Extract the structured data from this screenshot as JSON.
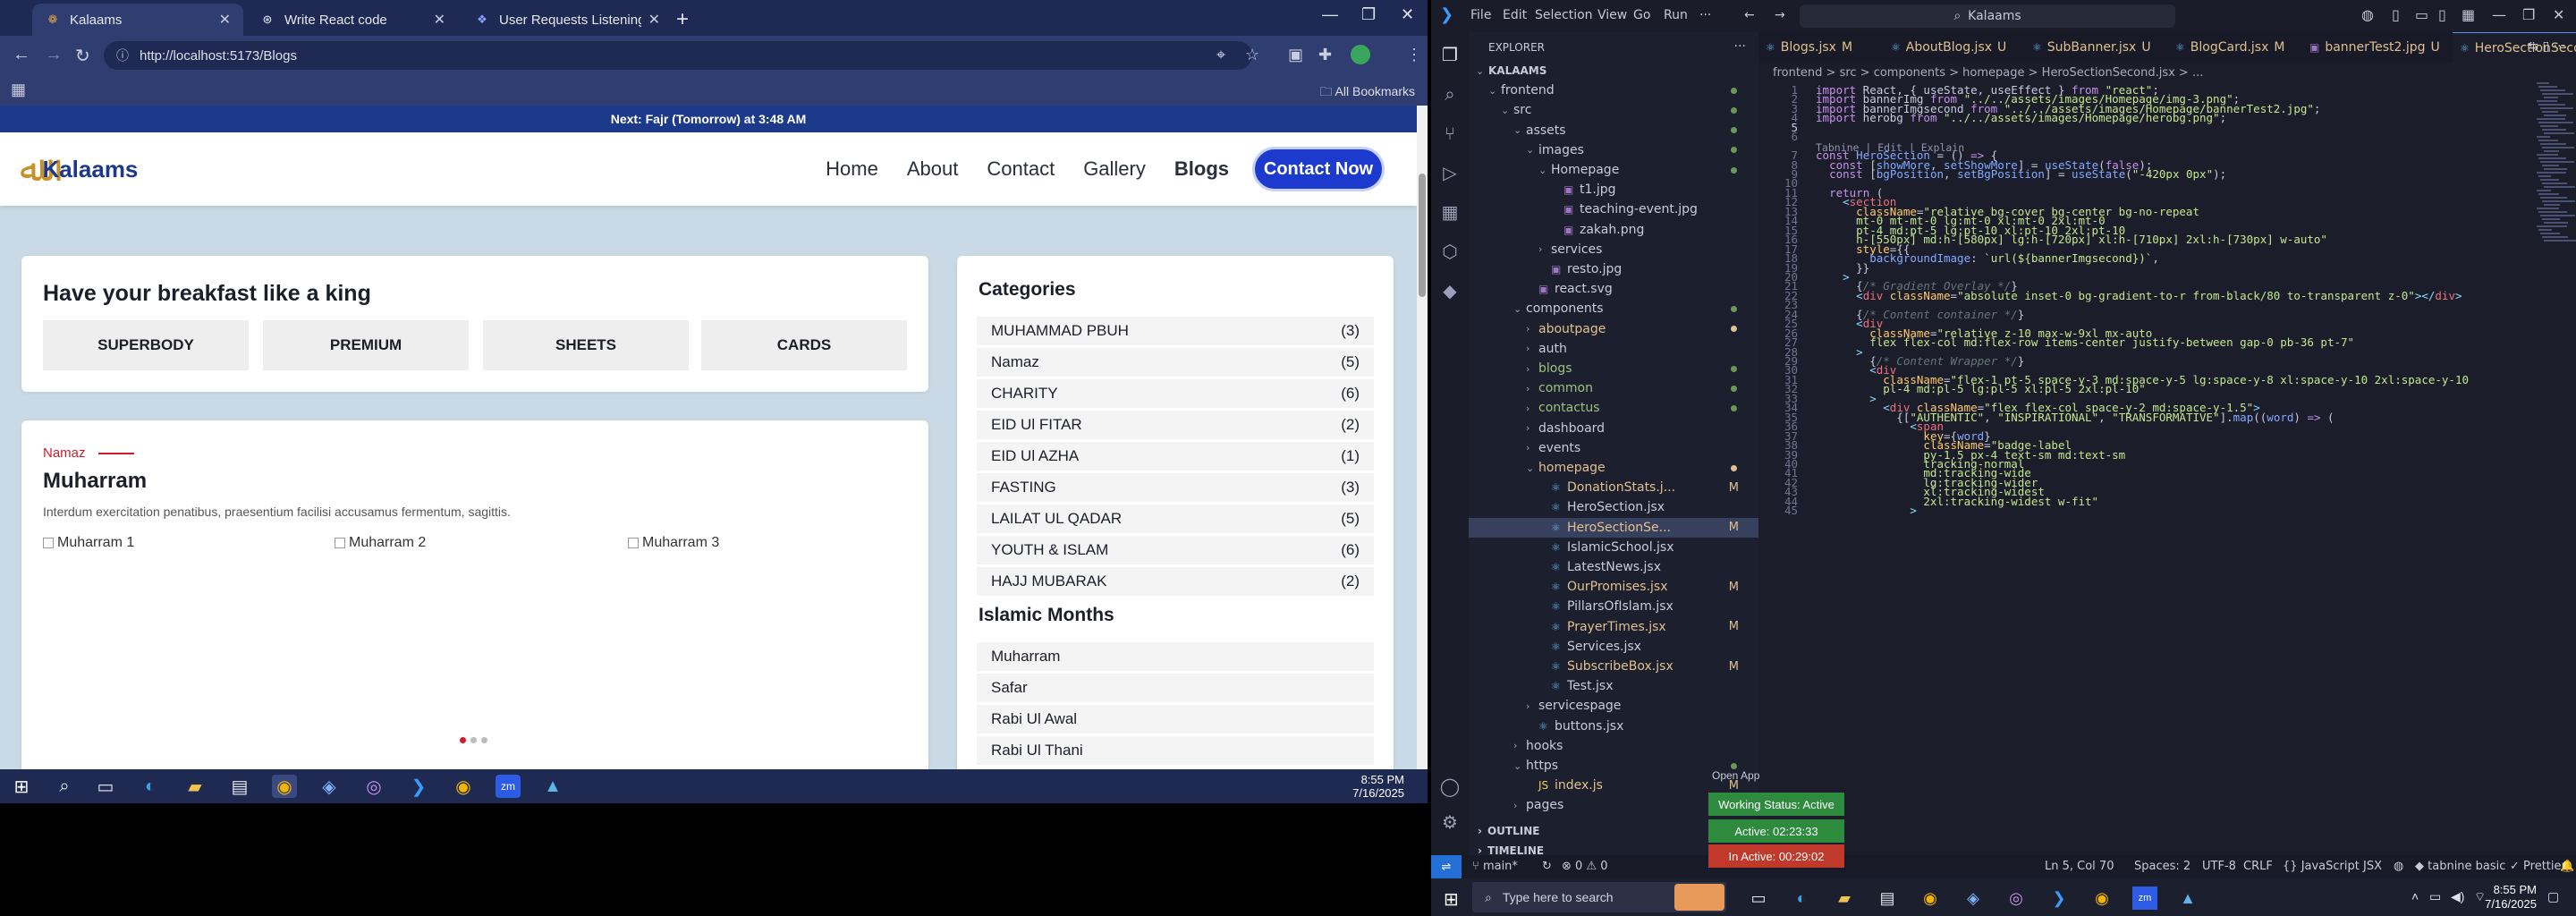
{
  "browser": {
    "tabs": [
      {
        "title": "Kalaams",
        "icon": "kalaams-favicon"
      },
      {
        "title": "Write React code",
        "icon": "chatgpt-favicon"
      },
      {
        "title": "User Requests Listening Assista",
        "icon": "assistant-favicon"
      }
    ],
    "new_tab": "+",
    "url": "http://localhost:5173/Blogs",
    "all_bookmarks": "All Bookmarks"
  },
  "site": {
    "prayer_bar": "Next: Fajr (Tomorrow) at 3:48 AM",
    "logo_mark": "ﷲ",
    "logo_text": "Kalaams",
    "nav": [
      "Home",
      "About",
      "Contact",
      "Gallery",
      "Blogs"
    ],
    "contact_btn": "Contact Now",
    "breakfast": {
      "title": "Have your breakfast like a king",
      "buttons": [
        "SUPERBODY",
        "PREMIUM",
        "SHEETS",
        "CARDS"
      ]
    },
    "post": {
      "eyebrow": "Namaz",
      "title": "Muharram",
      "text": "Interdum exercitation penatibus, praesentium facilisi accusamus fermentum, sagittis.",
      "images": [
        "Muharram 1",
        "Muharram 2",
        "Muharram 3"
      ]
    },
    "categories": {
      "title": "Categories",
      "items": [
        {
          "name": "MUHAMMAD PBUH",
          "count": "(3)"
        },
        {
          "name": "Namaz",
          "count": "(5)"
        },
        {
          "name": "CHARITY",
          "count": "(6)"
        },
        {
          "name": "EID Ul FITAR",
          "count": "(2)"
        },
        {
          "name": "EID Ul AZHA",
          "count": "(1)"
        },
        {
          "name": "FASTING",
          "count": "(3)"
        },
        {
          "name": "LAILAT UL QADAR",
          "count": "(5)"
        },
        {
          "name": "YOUTH & ISLAM",
          "count": "(6)"
        },
        {
          "name": "HAJJ MUBARAK",
          "count": "(2)"
        }
      ]
    },
    "months": {
      "title": "Islamic Months",
      "items": [
        "Muharram",
        "Safar",
        "Rabi Ul Awal",
        "Rabi Ul Thani"
      ]
    }
  },
  "taskbar_left": {
    "time": "8:55 PM",
    "date": "7/16/2025"
  },
  "vscode": {
    "menu": [
      "File",
      "Edit",
      "Selection",
      "View",
      "Go",
      "Run"
    ],
    "command_center": "Kalaams",
    "explorer_title": "EXPLORER",
    "tree": [
      {
        "label": "KALAAMS",
        "depth": 0,
        "chev": "v",
        "type": "root"
      },
      {
        "label": "frontend",
        "depth": 1,
        "chev": "v",
        "type": "folder",
        "dot": true
      },
      {
        "label": "src",
        "depth": 2,
        "chev": "v",
        "type": "folder",
        "dot": true
      },
      {
        "label": "assets",
        "depth": 3,
        "chev": "v",
        "type": "folder",
        "dot": true
      },
      {
        "label": "images",
        "depth": 4,
        "chev": "v",
        "type": "folder",
        "dot": true
      },
      {
        "label": "Homepage",
        "depth": 5,
        "chev": "v",
        "type": "folder",
        "dot": true
      },
      {
        "label": "t1.jpg",
        "depth": 6,
        "type": "img"
      },
      {
        "label": "teaching-event.jpg",
        "depth": 6,
        "type": "img"
      },
      {
        "label": "zakah.png",
        "depth": 6,
        "type": "img"
      },
      {
        "label": "services",
        "depth": 5,
        "chev": ">",
        "type": "folder"
      },
      {
        "label": "resto.jpg",
        "depth": 5,
        "type": "img"
      },
      {
        "label": "react.svg",
        "depth": 4,
        "type": "img"
      },
      {
        "label": "components",
        "depth": 3,
        "chev": "v",
        "type": "folder",
        "dot": true
      },
      {
        "label": "aboutpage",
        "depth": 4,
        "chev": ">",
        "type": "folder",
        "modc": true,
        "dot": true
      },
      {
        "label": "auth",
        "depth": 4,
        "chev": ">",
        "type": "folder"
      },
      {
        "label": "blogs",
        "depth": 4,
        "chev": ">",
        "type": "folder",
        "grn": true,
        "dot": true
      },
      {
        "label": "common",
        "depth": 4,
        "chev": ">",
        "type": "folder",
        "grn": true,
        "dot": true
      },
      {
        "label": "contactus",
        "depth": 4,
        "chev": ">",
        "type": "folder",
        "grn": true,
        "dot": true
      },
      {
        "label": "dashboard",
        "depth": 4,
        "chev": ">",
        "type": "folder"
      },
      {
        "label": "events",
        "depth": 4,
        "chev": ">",
        "type": "folder"
      },
      {
        "label": "homepage",
        "depth": 4,
        "chev": "v",
        "type": "folder",
        "modc": true,
        "dot": true
      },
      {
        "label": "DonationStats.j...",
        "depth": 5,
        "type": "jsx",
        "mod": "M",
        "modc": true
      },
      {
        "label": "HeroSection.jsx",
        "depth": 5,
        "type": "jsx"
      },
      {
        "label": "HeroSectionSe...",
        "depth": 5,
        "type": "jsx",
        "mod": "M",
        "modc": true,
        "sel": true
      },
      {
        "label": "IslamicSchool.jsx",
        "depth": 5,
        "type": "jsx"
      },
      {
        "label": "LatestNews.jsx",
        "depth": 5,
        "type": "jsx"
      },
      {
        "label": "OurPromises.jsx",
        "depth": 5,
        "type": "jsx",
        "mod": "M",
        "modc": true
      },
      {
        "label": "PillarsOfIslam.jsx",
        "depth": 5,
        "type": "jsx"
      },
      {
        "label": "PrayerTimes.jsx",
        "depth": 5,
        "type": "jsx",
        "mod": "M",
        "modc": true
      },
      {
        "label": "Services.jsx",
        "depth": 5,
        "type": "jsx"
      },
      {
        "label": "SubscribeBox.jsx",
        "depth": 5,
        "type": "jsx",
        "mod": "M",
        "modc": true
      },
      {
        "label": "Test.jsx",
        "depth": 5,
        "type": "jsx"
      },
      {
        "label": "servicespage",
        "depth": 4,
        "chev": ">",
        "type": "folder"
      },
      {
        "label": "buttons.jsx",
        "depth": 4,
        "type": "jsx"
      },
      {
        "label": "hooks",
        "depth": 3,
        "chev": ">",
        "type": "folder"
      },
      {
        "label": "https",
        "depth": 3,
        "chev": "v",
        "type": "folder",
        "dot": true
      },
      {
        "label": "index.js",
        "depth": 4,
        "type": "js",
        "mod": "M",
        "modc": true
      },
      {
        "label": "pages",
        "depth": 3,
        "chev": ">",
        "type": "folder",
        "dot": true
      }
    ],
    "sections": [
      "OUTLINE",
      "TIMELINE"
    ],
    "editor_tabs": [
      {
        "title": "Blogs.jsx",
        "mod": "M"
      },
      {
        "title": "AboutBlog.jsx",
        "mod": "U"
      },
      {
        "title": "SubBanner.jsx",
        "mod": "U"
      },
      {
        "title": "BlogCard.jsx",
        "mod": "M"
      },
      {
        "title": "bannerTest2.jpg",
        "mod": "U"
      },
      {
        "title": "HeroSectionSecond.jsx",
        "mod": "M",
        "active": true
      }
    ],
    "breadcrumbs": "frontend  >  src  >  components  >  homepage  >  HeroSectionSecond.jsx  >  ...",
    "codelens": "Tabnine | Edit | Explain",
    "code_lines": [
      {
        "n": "1",
        "html": "<span class=\"kw\">import</span> React, { useState, useEffect } <span class=\"kw\">from</span> <span class=\"str\">\"react\"</span>;"
      },
      {
        "n": "2",
        "html": "<span class=\"kw\">import</span> bannerImg <span class=\"kw\">from</span> <span class=\"str\">\"../../assets/images/Homepage/img-3.png\"</span>;"
      },
      {
        "n": "3",
        "html": "<span class=\"kw\">import</span> bannerImgsecond <span class=\"kw\">from</span> <span class=\"str\">\"../../assets/images/Homepage/bannerTest2.jpg\"</span>;"
      },
      {
        "n": "4",
        "html": "<span class=\"kw\">import</span> herobg <span class=\"kw\">from</span> <span class=\"str\">\"../../assets/images/Homepage/herobg.png\"</span>;"
      },
      {
        "n": "5",
        "html": "",
        "cur": true
      },
      {
        "n": "6",
        "html": ""
      },
      {
        "n": "7",
        "html": "<span class=\"kw\">const</span> <span class=\"fn\">HeroSection</span> = () <span class=\"kw\">=&gt;</span> {"
      },
      {
        "n": "8",
        "html": "  <span class=\"kw\">const</span> [<span class=\"var\">showMore</span>, <span class=\"var\">setShowMore</span>] = <span class=\"fn\">useState</span>(<span class=\"kw\">false</span>);"
      },
      {
        "n": "9",
        "html": "  <span class=\"kw\">const</span> [<span class=\"var\">bgPosition</span>, <span class=\"var\">setBgPosition</span>] = <span class=\"fn\">useState</span>(<span class=\"str\">\"-420px 0px\"</span>);"
      },
      {
        "n": "10",
        "html": ""
      },
      {
        "n": "11",
        "html": "  <span class=\"kw\">return</span> ("
      },
      {
        "n": "12",
        "html": "    <span class=\"pun\">&lt;</span><span class=\"tag\">section</span>"
      },
      {
        "n": "13",
        "html": "      <span class=\"attr\">className</span>=<span class=\"str\">\"relative bg-cover bg-center bg-no-repeat</span>"
      },
      {
        "n": "14",
        "html": "<span class=\"str\">      mt-0 mt-mt-0 lg:mt-0 xl:mt-0 2xl:mt-0</span>"
      },
      {
        "n": "15",
        "html": "<span class=\"str\">      pt-4 md:pt-5 lg:pt-10 xl:pt-10 2xl:pt-10</span>"
      },
      {
        "n": "16",
        "html": "<span class=\"str\">      h-[550px] md:h-[580px] lg:h-[720px] xl:h-[710px] 2xl:h-[730px] w-auto\"</span>"
      },
      {
        "n": "17",
        "html": "      <span class=\"attr\">style</span>={{"
      },
      {
        "n": "18",
        "html": "        <span class=\"var\">backgroundImage</span>: <span class=\"str\">`url(${bannerImgsecond})`</span>,"
      },
      {
        "n": "19",
        "html": "      }}"
      },
      {
        "n": "20",
        "html": "    <span class=\"pun\">&gt;</span>"
      },
      {
        "n": "21",
        "html": "      {<span class=\"cmt\">/* Gradient Overlay */</span>}"
      },
      {
        "n": "22",
        "html": "      <span class=\"pun\">&lt;</span><span class=\"tag\">div</span> <span class=\"attr\">className</span>=<span class=\"str\">\"absolute inset-0 bg-gradient-to-r from-black/80 to-transparent z-0\"</span><span class=\"pun\">&gt;&lt;/</span><span class=\"tag\">div</span><span class=\"pun\">&gt;</span>"
      },
      {
        "n": "23",
        "html": ""
      },
      {
        "n": "24",
        "html": "      {<span class=\"cmt\">/* Content container */</span>}"
      },
      {
        "n": "25",
        "html": "      <span class=\"pun\">&lt;</span><span class=\"tag\">div</span>"
      },
      {
        "n": "26",
        "html": "        <span class=\"attr\">className</span>=<span class=\"str\">\"relative z-10 max-w-9xl mx-auto</span>"
      },
      {
        "n": "27",
        "html": "<span class=\"str\">        flex flex-col md:flex-row items-center justify-between gap-0 pb-36 pt-7\"</span>"
      },
      {
        "n": "28",
        "html": "      <span class=\"pun\">&gt;</span>"
      },
      {
        "n": "29",
        "html": "        {<span class=\"cmt\">/* Content Wrapper */</span>}"
      },
      {
        "n": "30",
        "html": "        <span class=\"pun\">&lt;</span><span class=\"tag\">div</span>"
      },
      {
        "n": "31",
        "html": "          <span class=\"attr\">className</span>=<span class=\"str\">\"flex-1 pt-5 space-y-3 md:space-y-5 lg:space-y-8 xl:space-y-10 2xl:space-y-10</span>"
      },
      {
        "n": "32",
        "html": "<span class=\"str\">          pl-4 md:pl-5 lg:pl-5 xl:pl-5 2xl:pl-10\"</span>"
      },
      {
        "n": "33",
        "html": "        <span class=\"pun\">&gt;</span>"
      },
      {
        "n": "34",
        "html": "          <span class=\"pun\">&lt;</span><span class=\"tag\">div</span> <span class=\"attr\">className</span>=<span class=\"str\">\"flex flex-col space-y-2 md:space-y-1.5\"</span><span class=\"pun\">&gt;</span>"
      },
      {
        "n": "35",
        "html": "            {[<span class=\"str\">\"AUTHENTIC\"</span>, <span class=\"str\">\"INSPIRATIONAL\"</span>, <span class=\"str\">\"TRANSFORMATIVE\"</span>].<span class=\"fn\">map</span>((<span class=\"var\">word</span>) <span class=\"kw\">=&gt;</span> ("
      },
      {
        "n": "36",
        "html": "              <span class=\"pun\">&lt;</span><span class=\"tag\">span</span>"
      },
      {
        "n": "37",
        "html": "                <span class=\"attr\">key</span>={<span class=\"var\">word</span>}"
      },
      {
        "n": "38",
        "html": "                <span class=\"attr\">className</span>=<span class=\"str\">\"badge-label</span>"
      },
      {
        "n": "39",
        "html": "<span class=\"str\">                py-1.5 px-4 text-sm md:text-sm</span>"
      },
      {
        "n": "40",
        "html": "<span class=\"str\">                tracking-normal</span>"
      },
      {
        "n": "41",
        "html": "<span class=\"str\">                md:tracking-wide</span>"
      },
      {
        "n": "42",
        "html": "<span class=\"str\">                lg:tracking-wider</span>"
      },
      {
        "n": "43",
        "html": "<span class=\"str\">                xl:tracking-widest</span>"
      },
      {
        "n": "44",
        "html": "<span class=\"str\">                2xl:tracking-widest w-fit\"</span>"
      },
      {
        "n": "45",
        "html": "              <span class=\"pun\">&gt;</span>"
      }
    ],
    "status": {
      "branch": "main*",
      "problems": "0 ⚠ 0",
      "position": "Ln 5, Col 70",
      "spaces": "Spaces: 2",
      "encoding": "UTF-8",
      "eol": "CRLF",
      "language": "JavaScript JSX",
      "tabnine": "tabnine basic",
      "prettier": "Prettier"
    },
    "open_app": "Open App",
    "badges": [
      {
        "text": "Working Status: Active",
        "color": "#2e8b3e"
      },
      {
        "text": "Active: 02:23:33",
        "color": "#2e8b3e"
      },
      {
        "text": "In Active: 00:29:02",
        "color": "#c0392b"
      }
    ]
  },
  "taskbar_right": {
    "search_placeholder": "Type here to search",
    "time": "8:55 PM",
    "date": "7/16/2025"
  }
}
